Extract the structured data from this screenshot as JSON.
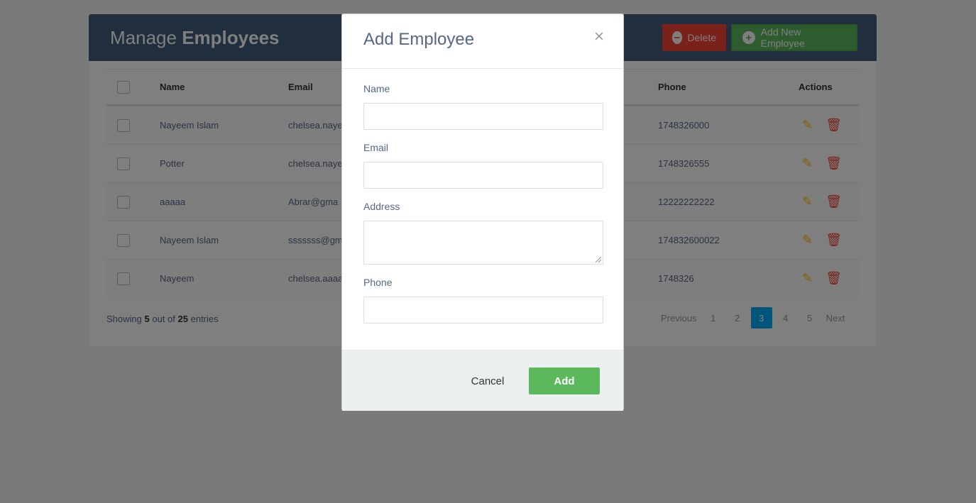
{
  "page": {
    "title_regular": "Manage",
    "title_bold": "Employees",
    "delete_label": "Delete",
    "add_new_label": "Add New Employee"
  },
  "table": {
    "headers": {
      "name": "Name",
      "email": "Email",
      "phone": "Phone",
      "actions": "Actions"
    },
    "rows": [
      {
        "name": "Nayeem Islam",
        "email": "chelsea.naye",
        "phone": "1748326000"
      },
      {
        "name": "Potter",
        "email": "chelsea.naye",
        "phone": "1748326555"
      },
      {
        "name": "aaaaa",
        "email": "Abrar@gma",
        "phone": "12222222222"
      },
      {
        "name": "Nayeem Islam",
        "email": "sssssss@gm",
        "phone": "174832600022"
      },
      {
        "name": "Nayeem",
        "email": "chelsea.aaaa",
        "phone": "1748326"
      }
    ]
  },
  "footer": {
    "showing_prefix": "Showing",
    "shown": "5",
    "out_of": "out of",
    "total": "25",
    "entries": "entries"
  },
  "pagination": {
    "previous": "Previous",
    "pages": [
      "1",
      "2",
      "3",
      "4",
      "5"
    ],
    "active_page": "3",
    "next": "Next"
  },
  "modal": {
    "title": "Add Employee",
    "close": "×",
    "fields": {
      "name_label": "Name",
      "email_label": "Email",
      "address_label": "Address",
      "phone_label": "Phone"
    },
    "cancel_label": "Cancel",
    "add_label": "Add"
  },
  "icons": {
    "delete_circle": "minus-circle-icon",
    "add_circle": "plus-circle-icon",
    "edit": "pencil-icon",
    "trash": "trash-icon",
    "close": "close-icon"
  },
  "colors": {
    "header_bg": "#435d7d",
    "delete_red": "#f44336",
    "add_green": "#5cb85c",
    "edit_yellow": "#ffc107",
    "page_active": "#03a9f4"
  }
}
